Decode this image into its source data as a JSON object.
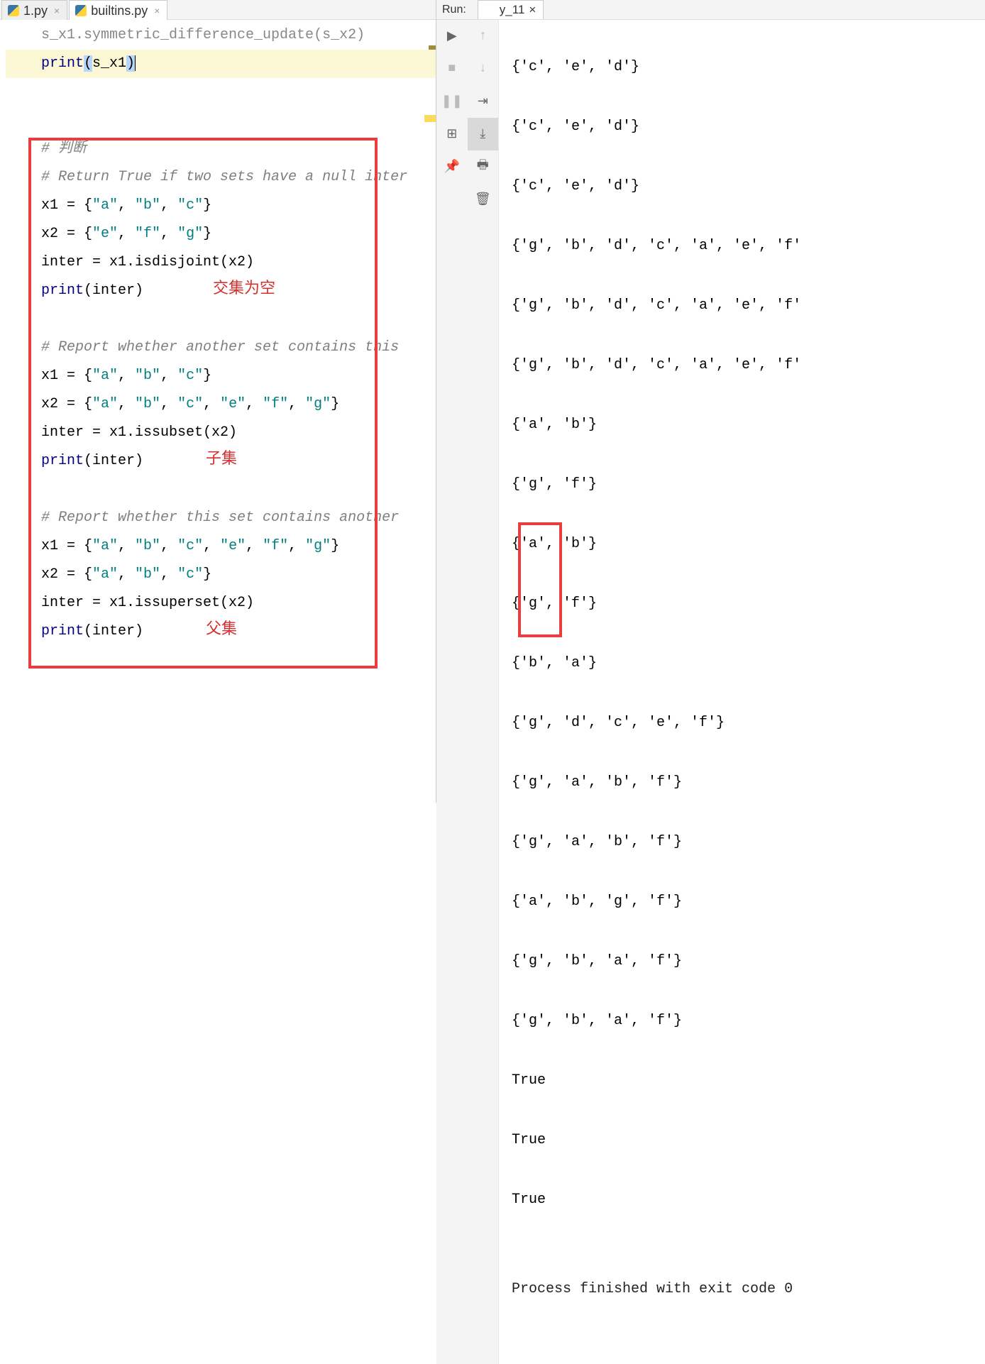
{
  "tabs": {
    "left1": "1.py",
    "left2": "builtins.py",
    "run_label": "Run:",
    "run_tab": "y_11"
  },
  "toolbar": {
    "play": "play-icon",
    "stop": "stop-icon",
    "pause": "pause-icon",
    "up": "up-icon",
    "down": "down-icon",
    "wrap": "wrap-icon",
    "scroll": "scroll-icon",
    "layout": "layout-icon",
    "print": "print-icon",
    "pin": "pin-icon",
    "trash": "trash-icon"
  },
  "code": {
    "l0a": "s_x1.symmetric_difference_update(s_x2)",
    "l0b_print": "print",
    "l0b_open": "(",
    "l0b_arg": "s_x1",
    "l0b_close": ")",
    "c1": "# 判断",
    "c2": "# Return True if two sets have a null inter",
    "a1": "x1 = {",
    "s_a": "\"a\"",
    "cm": ", ",
    "s_b": "\"b\"",
    "s_c": "\"c\"",
    "rb": "}",
    "a2": "x2 = {",
    "s_e": "\"e\"",
    "s_f": "\"f\"",
    "s_g": "\"g\"",
    "d1a": "inter = x1.isdisjoint(x2)",
    "pr": "print",
    "po": "(inter)",
    "ann1": "交集为空",
    "c3": "# Report whether another set contains this",
    "d2a": "inter = x1.issubset(x2)",
    "ann2": "子集",
    "c4": "# Report whether this set contains another",
    "d3a": "inter = x1.issuperset(x2)",
    "ann3": "父集"
  },
  "output": [
    "{'c', 'e', 'd'}",
    "{'c', 'e', 'd'}",
    "{'c', 'e', 'd'}",
    "{'g', 'b', 'd', 'c', 'a', 'e', 'f'",
    "{'g', 'b', 'd', 'c', 'a', 'e', 'f'",
    "{'g', 'b', 'd', 'c', 'a', 'e', 'f'",
    "{'a', 'b'}",
    "{'g', 'f'}",
    "{'a', 'b'}",
    "{'g', 'f'}",
    "{'b', 'a'}",
    "{'g', 'd', 'c', 'e', 'f'}",
    "{'g', 'a', 'b', 'f'}",
    "{'g', 'a', 'b', 'f'}",
    "{'a', 'b', 'g', 'f'}",
    "{'g', 'b', 'a', 'f'}",
    "{'g', 'b', 'a', 'f'}",
    "True",
    "True",
    "True",
    "",
    "Process finished with exit code 0"
  ]
}
